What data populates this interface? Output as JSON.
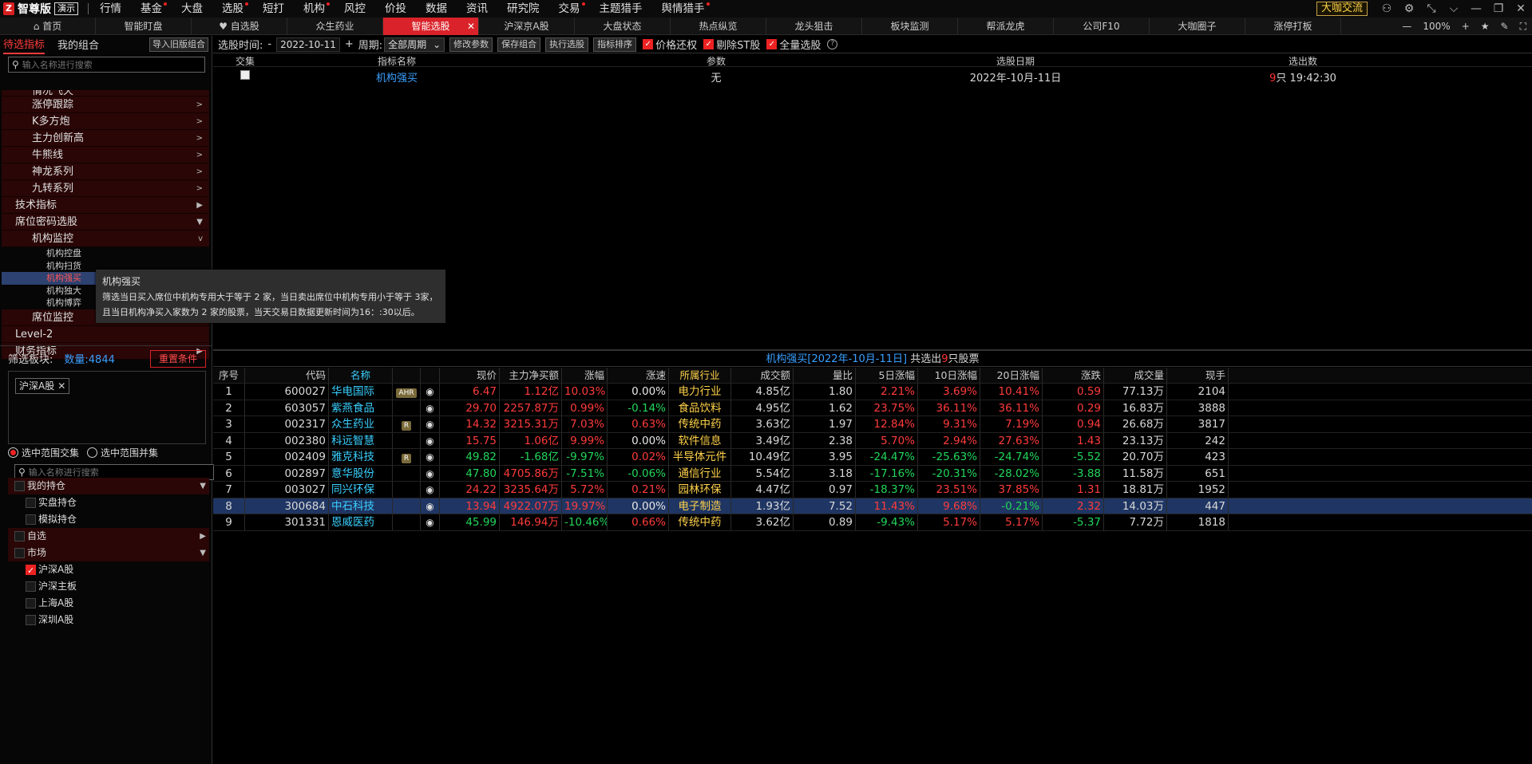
{
  "app": {
    "logo_icon": "Z",
    "name": "智尊版",
    "demo": "演示",
    "exchange": "大咖交流"
  },
  "menus": [
    {
      "label": "行情",
      "dot": false
    },
    {
      "label": "基金",
      "dot": true
    },
    {
      "label": "大盘",
      "dot": false
    },
    {
      "label": "选股",
      "dot": true
    },
    {
      "label": "短打",
      "dot": false
    },
    {
      "label": "机构",
      "dot": true
    },
    {
      "label": "风控",
      "dot": false
    },
    {
      "label": "价投",
      "dot": false
    },
    {
      "label": "数据",
      "dot": false
    },
    {
      "label": "资讯",
      "dot": false
    },
    {
      "label": "研究院",
      "dot": false
    },
    {
      "label": "交易",
      "dot": true
    },
    {
      "label": "主题猎手",
      "dot": false
    },
    {
      "label": "舆情猎手",
      "dot": true
    }
  ],
  "tabs": [
    {
      "label": "⌂ 首页"
    },
    {
      "label": "智能盯盘"
    },
    {
      "label": "♥ 自选股"
    },
    {
      "label": "众生药业"
    },
    {
      "label": "智能选股",
      "active": true
    },
    {
      "label": "沪深京A股"
    },
    {
      "label": "大盘状态"
    },
    {
      "label": "热点纵览"
    },
    {
      "label": "龙头狙击"
    },
    {
      "label": "板块监测"
    },
    {
      "label": "帮派龙虎"
    },
    {
      "label": "公司F10"
    },
    {
      "label": "大咖圈子"
    },
    {
      "label": "涨停打板"
    }
  ],
  "zoom": "100%",
  "left": {
    "tab_active": "待选指标",
    "tab_other": "我的组合",
    "import_btn": "导入旧版组合",
    "search_placeholder": "输入名称进行搜索",
    "tree": [
      {
        "label": "情况飞天",
        "level": "l2",
        "partial": true
      },
      {
        "label": "涨停跟踪",
        "level": "l2",
        "arrow": ">"
      },
      {
        "label": "K多方炮",
        "level": "l2",
        "arrow": ">"
      },
      {
        "label": "主力创新高",
        "level": "l2",
        "arrow": ">"
      },
      {
        "label": "牛熊线",
        "level": "l2",
        "arrow": ">"
      },
      {
        "label": "神龙系列",
        "level": "l2",
        "arrow": ">"
      },
      {
        "label": "九转系列",
        "level": "l2",
        "arrow": ">"
      },
      {
        "label": "技术指标",
        "level": "l1",
        "arrow": "▶"
      },
      {
        "label": "席位密码选股",
        "level": "l1",
        "arrow": "▼"
      },
      {
        "label": "机构监控",
        "level": "l2",
        "arrow": "v"
      },
      {
        "label": "机构控盘",
        "level": "leaf"
      },
      {
        "label": "机构扫货",
        "level": "leaf"
      },
      {
        "label": "机构强买",
        "level": "leaf",
        "sel": true
      },
      {
        "label": "机构独大",
        "level": "leaf"
      },
      {
        "label": "机构博弈",
        "level": "leaf"
      },
      {
        "label": "席位监控",
        "level": "l2",
        "arrow": ">"
      },
      {
        "label": "Level-2",
        "level": "l1",
        "arrow": ""
      },
      {
        "label": "财务指标",
        "level": "l1",
        "arrow": "▶"
      }
    ],
    "filter_label": "筛选板块:",
    "filter_count": "数量:4844",
    "reset_btn": "重置条件",
    "chip": "沪深A股",
    "radio1": "选中范围交集",
    "radio2": "选中范围并集",
    "search2_placeholder": "输入名称进行搜索",
    "tree2": [
      {
        "label": "我的持仓",
        "type": "grp",
        "arrow": "▼",
        "checked": false
      },
      {
        "label": "实盘持仓",
        "type": "item",
        "checked": false
      },
      {
        "label": "模拟持仓",
        "type": "item",
        "checked": false
      },
      {
        "label": "自选",
        "type": "grp",
        "arrow": "▶",
        "checked": false
      },
      {
        "label": "市场",
        "type": "grp",
        "arrow": "▼",
        "checked": false
      },
      {
        "label": "沪深A股",
        "type": "item",
        "checked": true
      },
      {
        "label": "沪深主板",
        "type": "item",
        "checked": false
      },
      {
        "label": "上海A股",
        "type": "item",
        "checked": false
      },
      {
        "label": "深圳A股",
        "type": "item",
        "checked": false
      }
    ]
  },
  "toolbar": {
    "time_label": "选股时间:",
    "minus": "-",
    "date": "2022-10-11",
    "plus": "+",
    "period_label": "周期:",
    "period": "全部周期",
    "btn_edit": "修改参数",
    "btn_save": "保存组合",
    "btn_run": "执行选股",
    "btn_sort": "指标排序",
    "chk1": "价格还权",
    "chk2": "剔除ST股",
    "chk3": "全量选股",
    "help": "?"
  },
  "top_table": {
    "headers": [
      "交集",
      "指标名称",
      "参数",
      "选股日期",
      "选出数"
    ],
    "row": {
      "name": "机构强买",
      "param": "无",
      "date": "2022年-10月-11日",
      "count": "9",
      "count_unit": "只 19:42:30"
    }
  },
  "tooltip": {
    "title": "机构强买",
    "line1": "筛选当日买入席位中机构专用大于等于 2 家，当日卖出席位中机构专用小于等于 3家，",
    "line2": "且当日机构净买入家数为 2 家的股票，当天交易日数据更新时间为16：:30以后。"
  },
  "result_title": {
    "title": "机构强买[2022年-10月-11日]",
    "mid": " 共选出",
    "count": "9",
    "tail": "只股票"
  },
  "columns": [
    "序号",
    "代码",
    "名称",
    "",
    "",
    "现价",
    "主力净买额",
    "涨幅",
    "涨速",
    "所属行业",
    "成交额",
    "量比",
    "5日涨幅",
    "10日涨幅",
    "20日涨幅",
    "涨跌",
    "成交量",
    "现手"
  ],
  "rows": [
    {
      "no": "1",
      "code": "600027",
      "name": "华电国际",
      "badge": "AHR",
      "price": "6.47",
      "net": "1.12亿",
      "chg": "10.03%",
      "speed": "0.00%",
      "ind": "电力行业",
      "amt": "4.85亿",
      "vr": "1.80",
      "d5": "2.21%",
      "d10": "3.69%",
      "d20": "10.41%",
      "diff": "0.59",
      "vol": "77.13万",
      "hand": "2104",
      "c": [
        "up",
        "up",
        "up",
        "wh",
        "up",
        "up",
        "up",
        "up"
      ]
    },
    {
      "no": "2",
      "code": "603057",
      "name": "紫燕食品",
      "badge": "",
      "price": "29.70",
      "net": "2257.87万",
      "chg": "0.99%",
      "speed": "-0.14%",
      "ind": "食品饮料",
      "amt": "4.95亿",
      "vr": "1.62",
      "d5": "23.75%",
      "d10": "36.11%",
      "d20": "36.11%",
      "diff": "0.29",
      "vol": "16.83万",
      "hand": "3888",
      "c": [
        "up",
        "up",
        "up",
        "dn",
        "up",
        "up",
        "up",
        "up"
      ]
    },
    {
      "no": "3",
      "code": "002317",
      "name": "众生药业",
      "badge": "R",
      "price": "14.32",
      "net": "3215.31万",
      "chg": "7.03%",
      "speed": "0.63%",
      "ind": "传统中药",
      "amt": "3.63亿",
      "vr": "1.97",
      "d5": "12.84%",
      "d10": "9.31%",
      "d20": "7.19%",
      "diff": "0.94",
      "vol": "26.68万",
      "hand": "3817",
      "c": [
        "up",
        "up",
        "up",
        "up",
        "up",
        "up",
        "up",
        "up"
      ]
    },
    {
      "no": "4",
      "code": "002380",
      "name": "科远智慧",
      "badge": "",
      "price": "15.75",
      "net": "1.06亿",
      "chg": "9.99%",
      "speed": "0.00%",
      "ind": "软件信息",
      "amt": "3.49亿",
      "vr": "2.38",
      "d5": "5.70%",
      "d10": "2.94%",
      "d20": "27.63%",
      "diff": "1.43",
      "vol": "23.13万",
      "hand": "242",
      "c": [
        "up",
        "up",
        "up",
        "wh",
        "up",
        "up",
        "up",
        "up"
      ]
    },
    {
      "no": "5",
      "code": "002409",
      "name": "雅克科技",
      "badge": "R",
      "price": "49.82",
      "net": "-1.68亿",
      "chg": "-9.97%",
      "speed": "0.02%",
      "ind": "半导体元件",
      "amt": "10.49亿",
      "vr": "3.95",
      "d5": "-24.47%",
      "d10": "-25.63%",
      "d20": "-24.74%",
      "diff": "-5.52",
      "vol": "20.70万",
      "hand": "423",
      "c": [
        "dn",
        "dn",
        "dn",
        "up",
        "dn",
        "dn",
        "dn",
        "dn"
      ]
    },
    {
      "no": "6",
      "code": "002897",
      "name": "意华股份",
      "badge": "",
      "price": "47.80",
      "net": "4705.86万",
      "chg": "-7.51%",
      "speed": "-0.06%",
      "ind": "通信行业",
      "amt": "5.54亿",
      "vr": "3.18",
      "d5": "-17.16%",
      "d10": "-20.31%",
      "d20": "-28.02%",
      "diff": "-3.88",
      "vol": "11.58万",
      "hand": "651",
      "c": [
        "dn",
        "up",
        "dn",
        "dn",
        "dn",
        "dn",
        "dn",
        "dn"
      ]
    },
    {
      "no": "7",
      "code": "003027",
      "name": "同兴环保",
      "badge": "",
      "price": "24.22",
      "net": "3235.64万",
      "chg": "5.72%",
      "speed": "0.21%",
      "ind": "园林环保",
      "amt": "4.47亿",
      "vr": "0.97",
      "d5": "-18.37%",
      "d10": "23.51%",
      "d20": "37.85%",
      "diff": "1.31",
      "vol": "18.81万",
      "hand": "1952",
      "c": [
        "up",
        "up",
        "up",
        "up",
        "dn",
        "up",
        "up",
        "up"
      ]
    },
    {
      "no": "8",
      "code": "300684",
      "name": "中石科技",
      "badge": "",
      "price": "13.94",
      "net": "4922.07万",
      "chg": "19.97%",
      "speed": "0.00%",
      "ind": "电子制造",
      "amt": "1.93亿",
      "vr": "7.52",
      "d5": "11.43%",
      "d10": "9.68%",
      "d20": "-0.21%",
      "diff": "2.32",
      "vol": "14.03万",
      "hand": "447",
      "sel": true,
      "c": [
        "up",
        "up",
        "up",
        "wh",
        "up",
        "up",
        "dn",
        "up"
      ]
    },
    {
      "no": "9",
      "code": "301331",
      "name": "恩威医药",
      "badge": "",
      "price": "45.99",
      "net": "146.94万",
      "chg": "-10.46%",
      "speed": "0.66%",
      "ind": "传统中药",
      "amt": "3.62亿",
      "vr": "0.89",
      "d5": "-9.43%",
      "d10": "5.17%",
      "d20": "5.17%",
      "diff": "-5.37",
      "vol": "7.72万",
      "hand": "1818",
      "c": [
        "dn",
        "up",
        "dn",
        "up",
        "dn",
        "up",
        "up",
        "dn"
      ]
    }
  ]
}
